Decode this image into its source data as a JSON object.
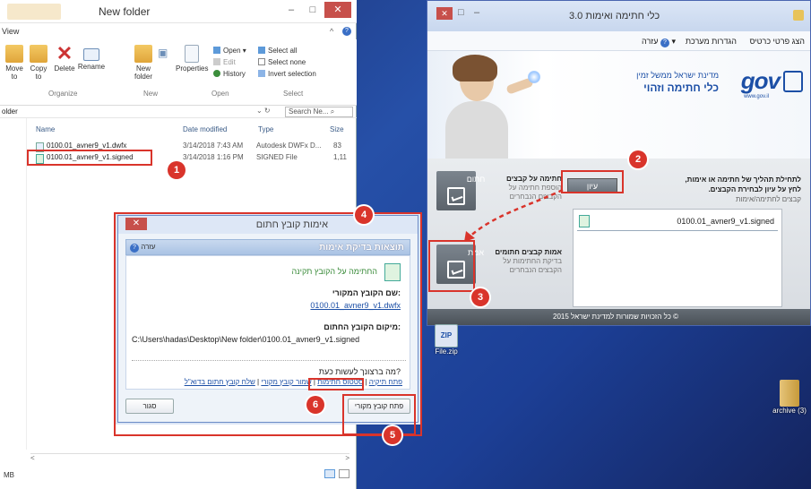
{
  "explorer": {
    "title": "New folder",
    "menu_view": "View",
    "ribbon": {
      "move_to": "Move to",
      "copy_to": "Copy to",
      "delete": "Delete",
      "rename": "Rename",
      "organize": "Organize",
      "new_folder": "New folder",
      "new_group": "New",
      "properties": "Properties",
      "open": "Open",
      "edit": "Edit",
      "history": "History",
      "open_group": "Open",
      "select_all": "Select all",
      "select_none": "Select none",
      "invert_selection": "Invert selection",
      "select_group": "Select"
    },
    "address_fragment": "older",
    "search_placeholder": "Search Ne...",
    "columns": {
      "name": "Name",
      "date": "Date modified",
      "type": "Type",
      "size": "Size"
    },
    "files": [
      {
        "name": "0100.01_avner9_v1.dwfx",
        "date": "3/14/2018 7:43 AM",
        "type": "Autodesk DWFx D...",
        "size": "83"
      },
      {
        "name": "0100.01_avner9_v1.signed",
        "date": "3/14/2018 1:16 PM",
        "type": "SIGNED File",
        "size": "1,11"
      }
    ],
    "status": "MB"
  },
  "dialog": {
    "title": "אימות קובץ חתום",
    "results_header": "תוצאות בדיקת אימות",
    "help": "עזרה",
    "valid_msg": "החתימה על הקובץ תקינה",
    "original_label": "שם הקובץ המקורי:",
    "original_name": "0100.01_avner9_v1.dwfx",
    "signed_location_label": "מיקום הקובץ החתום:",
    "signed_path": "C:\\Users\\hadas\\Desktop\\New folder\\0100.01_avner9_v1.signed",
    "what_next": "מה ברצונך לעשות כעת?",
    "action_open_folder": "פתח תיקיה",
    "action_signatures": "סטטוס חתימות",
    "action_save_original": "שמור קובץ מקורי",
    "action_send_mail": "שלח קובץ חתום בדוא\"ל",
    "close_button": "סגור",
    "open_original_button": "פתח קובץ מקורי"
  },
  "signtool": {
    "title": "כלי חתימה ואימות 3.0",
    "menu": [
      "הצג פרטי כרטיס",
      "הגדרות מערכת",
      "עזרה"
    ],
    "gov_line1": "מדינת ישראל ממשל זמין",
    "gov_line2": "כלי חתימה וזהוי",
    "gov_logo": "gov",
    "gov_url": "www.gov.il",
    "instructions_line1": "לתחילת תהליך של חתימה או אימות,",
    "instructions_line2": "לחץ על עיון לבחירת הקבצים.",
    "files_for_sign": "קבצים לחתימה/אימות",
    "browse_button": "עיון",
    "sign_box_label": "חתום",
    "sign_title": "חתימה על קבצים",
    "sign_desc1": "הוספת חתימה על",
    "sign_desc2": "הקבצים הנבחרים",
    "verify_box_label": "אמת",
    "verify_title": "אמות קבצים חתומים",
    "verify_desc1": "בדיקת החתימות על",
    "verify_desc2": "הקבצים הנבחרים",
    "selected_file": "0100.01_avner9_v1.signed",
    "footer": "© כל הזכויות שמורות למדינת ישראל 2015"
  },
  "desktop": {
    "zip_label": "File.zip",
    "zip_tag": "ZIP",
    "archive_label": "archive (3)"
  },
  "badges": [
    "1",
    "2",
    "3",
    "4",
    "5",
    "6"
  ],
  "colors": {
    "annotation_red": "#d9342b",
    "gov_blue": "#1c4fa6",
    "gov_green": "#2d8a2d"
  }
}
